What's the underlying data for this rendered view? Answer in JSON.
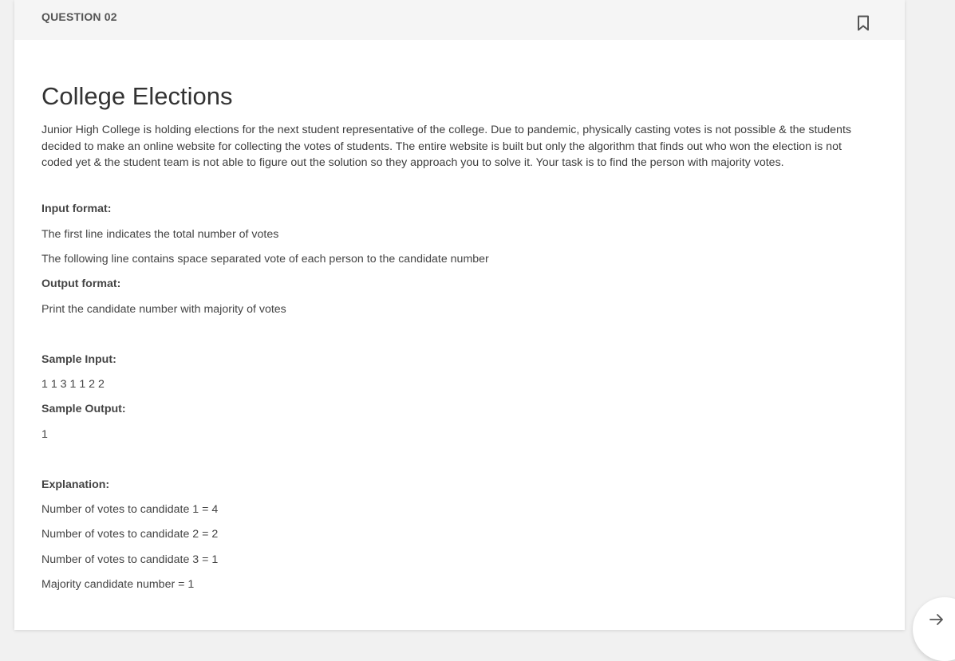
{
  "header": {
    "question_number": "QUESTION 02"
  },
  "question": {
    "title": "College Elections",
    "description": "Junior High College is holding elections for the next student representative of the college. Due to pandemic, physically casting votes is not possible & the students decided to make an online website for collecting the votes of students. The entire website is built but only the algorithm that finds out who won the election is not coded yet & the student team is not able to figure out the solution so they approach you to solve it. Your task is to find the person with majority votes.",
    "input_format_label": "Input format:",
    "input_format_lines": [
      "The first line indicates the total number of votes",
      "The following line contains space separated vote of each person to the candidate number"
    ],
    "output_format_label": "Output format:",
    "output_format_lines": [
      "Print the candidate number with majority of votes"
    ],
    "sample_input_label": "Sample Input:",
    "sample_input": "1 1 3 1 1 2 2",
    "sample_output_label": "Sample Output:",
    "sample_output": "1",
    "explanation_label": "Explanation:",
    "explanation_lines": [
      "Number of votes to candidate 1 = 4",
      "Number of votes to candidate 2 = 2",
      "Number of votes to candidate 3 = 1",
      "Majority candidate number = 1"
    ]
  },
  "icons": {
    "bookmark": "bookmark-icon",
    "next": "arrow-right-icon"
  },
  "colors": {
    "header_bg": "#f5f5f5",
    "page_bg": "#f1f1f1",
    "card_bg": "#ffffff",
    "text": "#333333"
  }
}
